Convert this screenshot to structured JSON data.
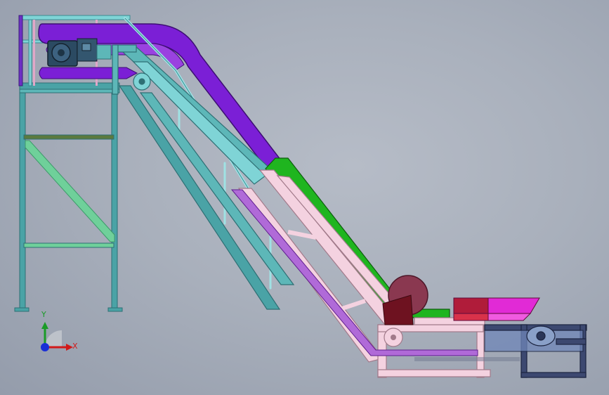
{
  "viewport": {
    "background": "#a9b0bc"
  },
  "model": {
    "components": [
      "support-frame",
      "stairs",
      "handrail",
      "belt-upper-purple",
      "belt-incline-green",
      "drive-motor",
      "tail-pulley",
      "feed-hopper",
      "base-frame"
    ],
    "colors": {
      "frame_steel": "#4aa3a6",
      "belt_purple": "#7b1fd6",
      "belt_green": "#1fb51f",
      "belt_return": "#b06ad8",
      "lower_frame_pink": "#f4d2e0",
      "hopper_magenta": "#e12ad6",
      "hopper_red": "#b01c3a",
      "motor_blue": "#2b4a62",
      "base_navy": "#3c4870",
      "brace_green": "#6fd09a",
      "crossbar_olive": "#5b7a3e"
    }
  },
  "triad": {
    "axis_x": "X",
    "axis_y": "Y",
    "icon": "coordinate-triad-icon",
    "x_color": "#d11a1a",
    "y_color": "#1a9b27",
    "z_color": "#1a2fd6"
  }
}
